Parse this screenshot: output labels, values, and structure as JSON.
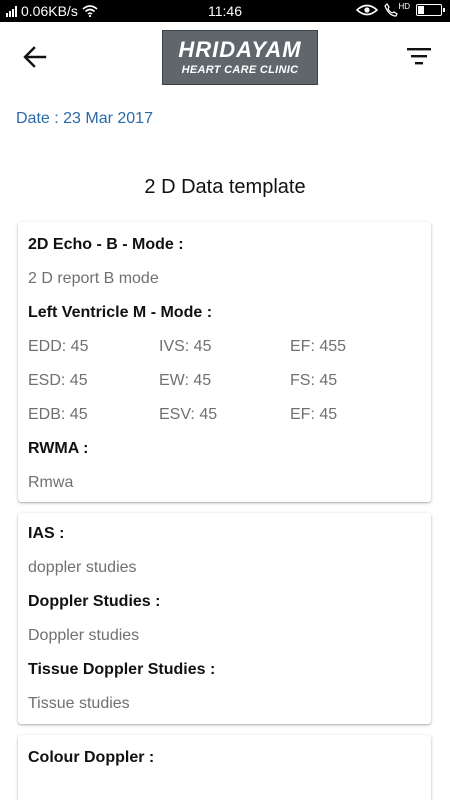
{
  "status_bar": {
    "speed": "0.06KB/s",
    "time": "11:46",
    "hd": "HD",
    "battery_level": 0.3,
    "icons": [
      "signal-icon",
      "wifi-icon",
      "eye-icon",
      "call-hd-icon",
      "battery-icon"
    ]
  },
  "header": {
    "logo_line1": "HRIDAYAM",
    "logo_line2": "HEART CARE CLINIC",
    "icons": [
      "back-arrow-icon",
      "filter-menu-icon"
    ]
  },
  "date": "Date : 23 Mar 2017",
  "title": "2 D Data template",
  "card1": {
    "echo_label": "2D Echo - B - Mode :",
    "echo_value": "2 D report B mode",
    "lv_label": "Left Ventricle M - Mode :",
    "lv_values": [
      "EDD: 45",
      "IVS: 45",
      "EF: 455",
      "ESD: 45",
      "EW: 45",
      "FS: 45",
      "EDB: 45",
      "ESV: 45",
      "EF: 45"
    ],
    "rwma_label": "RWMA :",
    "rwma_value": "Rmwa"
  },
  "card2": {
    "ias_label": "IAS :",
    "ias_value": "doppler studies",
    "doppler_label": "Doppler Studies :",
    "doppler_value": "Doppler studies",
    "tissue_label": "Tissue Doppler Studies :",
    "tissue_value": "Tissue studies"
  },
  "card3": {
    "colour_label": "Colour Doppler :"
  },
  "colors": {
    "accent": "#2a6aa8",
    "muted_text": "#707070",
    "logo_bg": "#5f666c"
  }
}
